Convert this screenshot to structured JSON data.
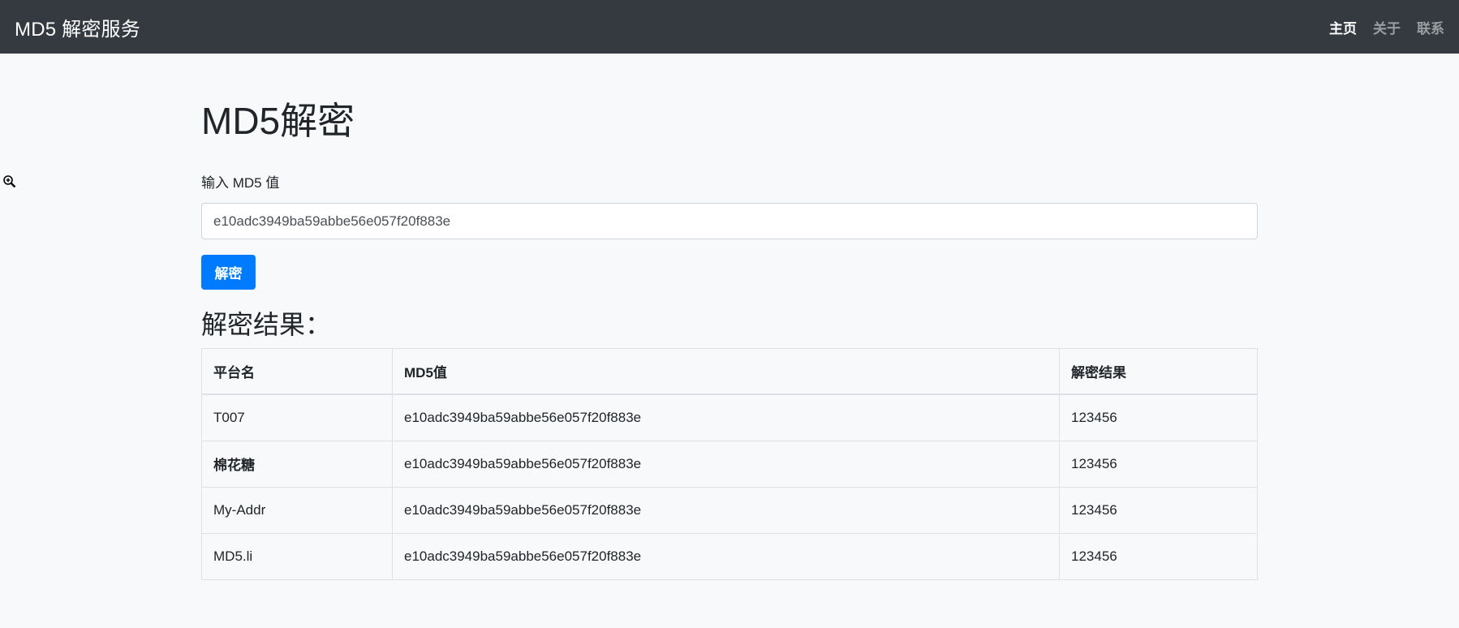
{
  "navbar": {
    "brand": "MD5 解密服务",
    "links": [
      {
        "label": "主页",
        "active": true
      },
      {
        "label": "关于",
        "active": false
      },
      {
        "label": "联系",
        "active": false
      }
    ]
  },
  "main": {
    "title": "MD5解密",
    "input_label": "输入 MD5 值",
    "input_value": "e10adc3949ba59abbe56e057f20f883e",
    "decrypt_button": "解密",
    "results_heading": "解密结果："
  },
  "table": {
    "headers": [
      "平台名",
      "MD5值",
      "解密结果"
    ],
    "rows": [
      [
        "T007",
        "e10adc3949ba59abbe56e057f20f883e",
        "123456"
      ],
      [
        "棉花糖",
        "e10adc3949ba59abbe56e057f20f883e",
        "123456"
      ],
      [
        "My-Addr",
        "e10adc3949ba59abbe56e057f20f883e",
        "123456"
      ],
      [
        "MD5.li",
        "e10adc3949ba59abbe56e057f20f883e",
        "123456"
      ]
    ]
  },
  "colors": {
    "navbar_bg": "#343a40",
    "primary": "#007bff",
    "page_bg": "#f8f9fa"
  },
  "icons": {
    "cursor": "zoom-in-icon"
  }
}
